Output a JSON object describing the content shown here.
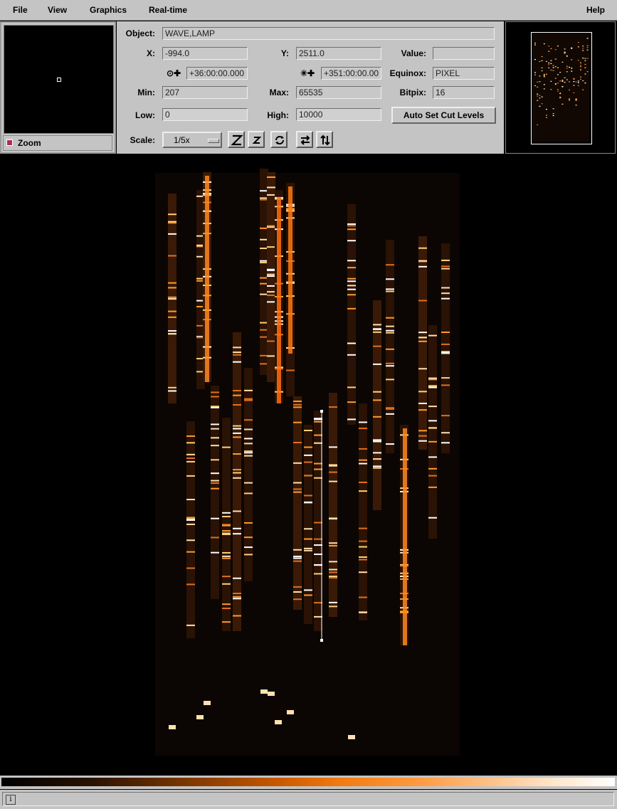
{
  "menu": {
    "file": "File",
    "view": "View",
    "graphics": "Graphics",
    "realtime": "Real-time",
    "help": "Help"
  },
  "zoom": {
    "label": "Zoom"
  },
  "info": {
    "object_label": "Object:",
    "object_value": "WAVE,LAMP",
    "x_label": "X:",
    "x_value": "-994.0",
    "y_label": "Y:",
    "y_value": "2511.0",
    "value_label": "Value:",
    "value_value": "",
    "ra_value": "+36:00:00.000",
    "dec_value": "+351:00:00.00",
    "equinox_label": "Equinox:",
    "equinox_value": "PIXEL",
    "min_label": "Min:",
    "min_value": "207",
    "max_label": "Max:",
    "max_value": "65535",
    "bitpix_label": "Bitpix:",
    "bitpix_value": "16",
    "low_label": "Low:",
    "low_value": "0",
    "high_label": "High:",
    "high_value": "10000",
    "autocut_label": "Auto Set Cut Levels",
    "scale_label": "Scale:",
    "scale_value": "1/5x"
  },
  "toolbar_icons": [
    "zoom-in-icon",
    "zoom-out-icon",
    "rotate-icon",
    "flip-x-icon",
    "flip-y-icon"
  ],
  "status": {
    "text": ""
  },
  "colors": {
    "panel": "#c4c4c4",
    "lut_mid": "#f07a10"
  }
}
